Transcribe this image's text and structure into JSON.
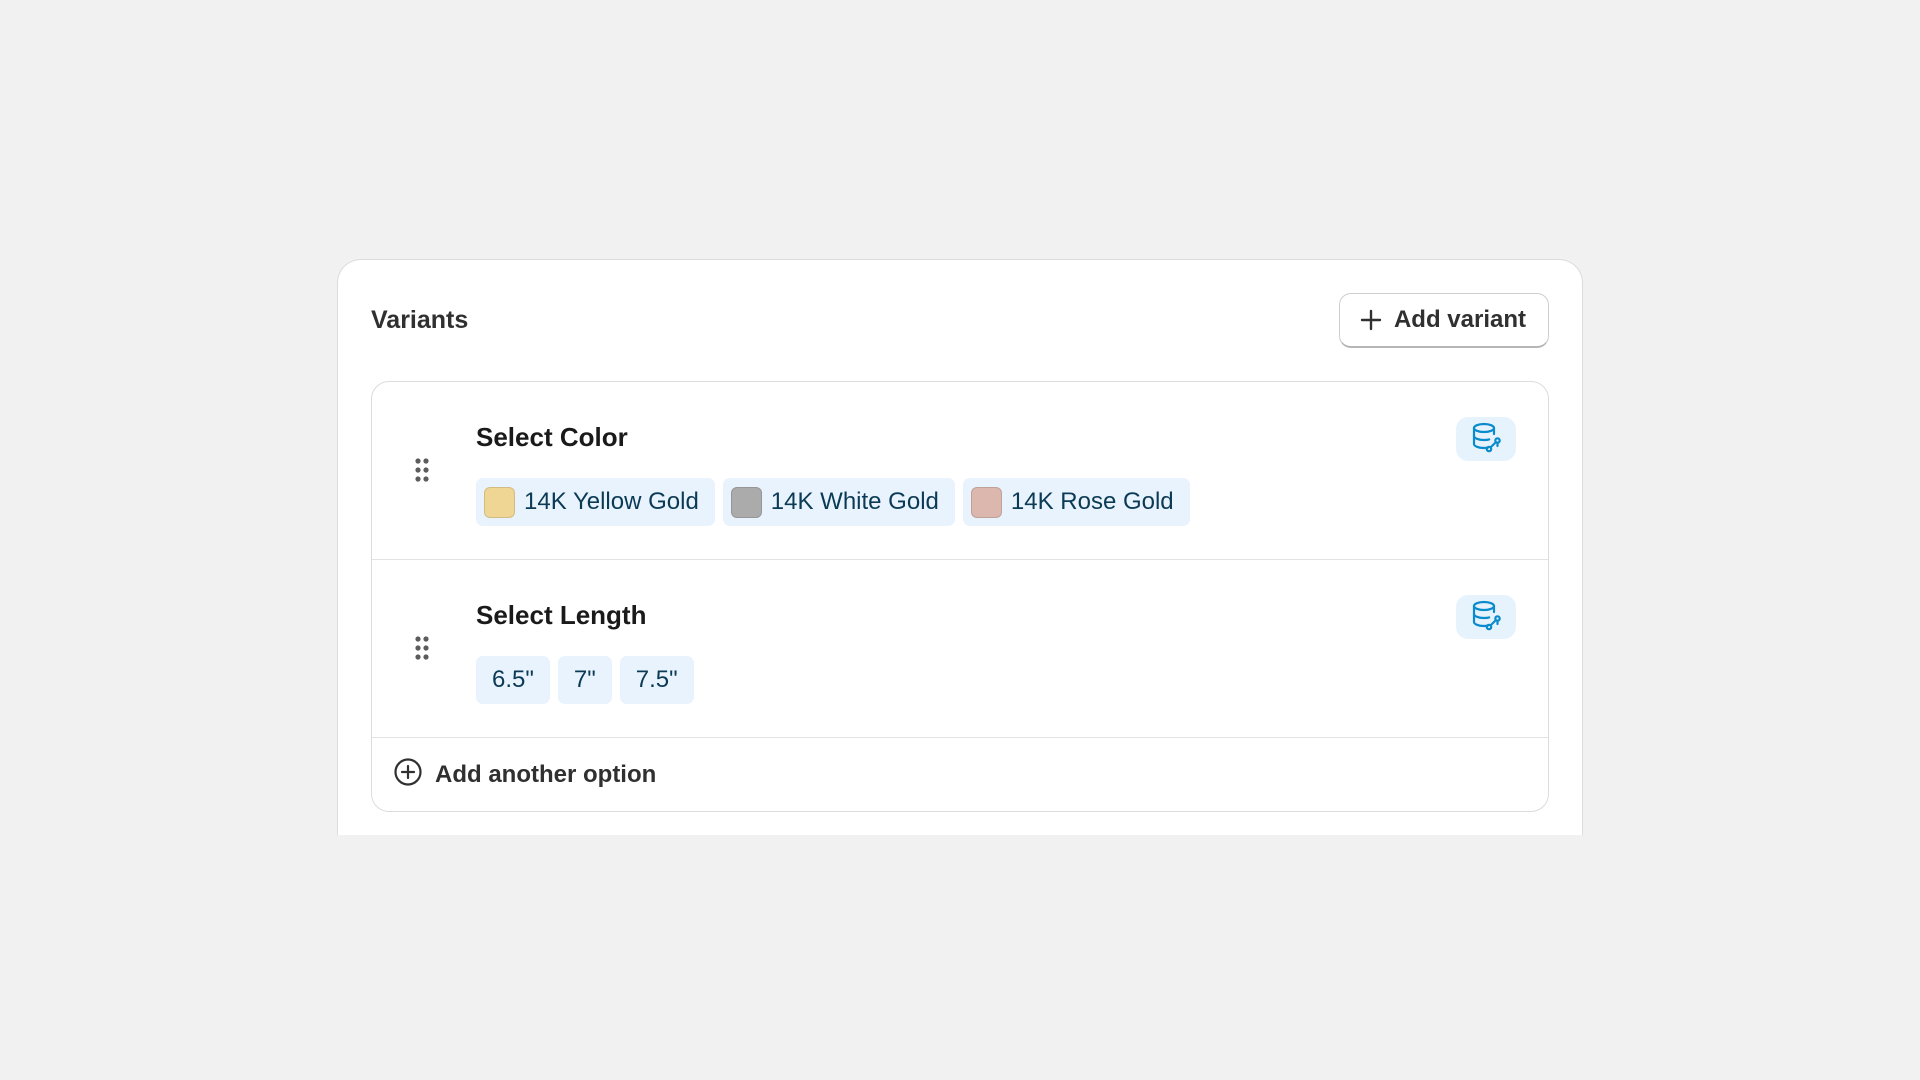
{
  "card": {
    "title": "Variants",
    "add_variant_label": "Add variant",
    "icons": {
      "add_variant": "plus-icon",
      "drag": "drag-handle-icon",
      "metafield": "database-link-icon",
      "add_option": "plus-circle-icon"
    }
  },
  "options": [
    {
      "title": "Select Color",
      "values": [
        {
          "label": "14K Yellow Gold",
          "swatch": "#efd694"
        },
        {
          "label": "14K White Gold",
          "swatch": "#ababab"
        },
        {
          "label": "14K Rose Gold",
          "swatch": "#dcb7ad"
        }
      ]
    },
    {
      "title": "Select Length",
      "values": [
        {
          "label": "6.5\""
        },
        {
          "label": "7\""
        },
        {
          "label": "7.5\""
        }
      ]
    }
  ],
  "add_option_label": "Add another option",
  "colors": {
    "accent": "#0a8ccc",
    "chip_bg": "#e8f3fd",
    "chip_text": "#0b3a55"
  }
}
